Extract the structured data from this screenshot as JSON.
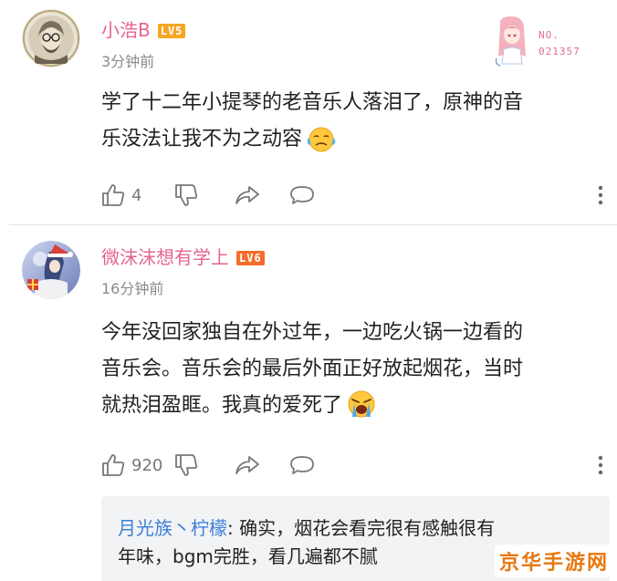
{
  "comments": [
    {
      "username": "小浩B",
      "level": "LV5",
      "time": "3分钟前",
      "content_lines": [
        "学了十二年小提琴的老音乐人落泪了，原神的音",
        "乐没法让我不为之动容"
      ],
      "emoji": "crying-emoji",
      "like_count": "4",
      "badge": {
        "line1": "NO.",
        "line2": "021357"
      }
    },
    {
      "username": "微沫沫想有学上",
      "level": "LV6",
      "time": "16分钟前",
      "content_lines": [
        "今年没回家独自在外过年，一边吃火锅一边看的",
        "音乐会。音乐会的最后外面正好放起烟花，当时",
        "就热泪盈眶。我真的爱死了"
      ],
      "emoji": "loud-crying-emoji",
      "like_count": "920",
      "reply": {
        "author": "月光族丶柠檬",
        "text_first": ": 确实，烟花会看完很有感触很有",
        "text_second": "年味，bgm完胜，看几遍都不腻"
      }
    }
  ],
  "icons": {
    "like": "thumbs-up-icon",
    "dislike": "thumbs-down-icon",
    "share": "share-icon",
    "reply": "comment-icon",
    "more": "more-vertical-icon"
  },
  "colors": {
    "username": "#e5658f",
    "lv5": "#f6a623",
    "lv6": "#f56d2c",
    "reply_author": "#3d7fd9",
    "watermark": "#e8770f"
  },
  "watermark": "京华手游网"
}
